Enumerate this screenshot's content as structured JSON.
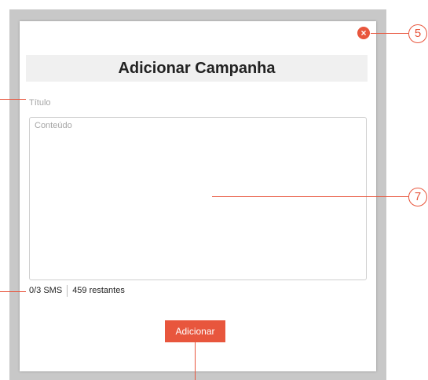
{
  "modal": {
    "title": "Adicionar Campanha",
    "close_glyph": "×"
  },
  "form": {
    "title_placeholder": "Título",
    "content_placeholder": "Conteúdo",
    "sms_count": "0/3 SMS",
    "remaining": "459 restantes",
    "submit_label": "Adicionar"
  },
  "annotations": {
    "callout_close": "5",
    "callout_content": "7"
  },
  "colors": {
    "accent": "#e8563d",
    "backdrop": "#c8c8c8",
    "title_bar": "#f0f0f0"
  },
  "icons": {
    "close": "close-icon"
  }
}
